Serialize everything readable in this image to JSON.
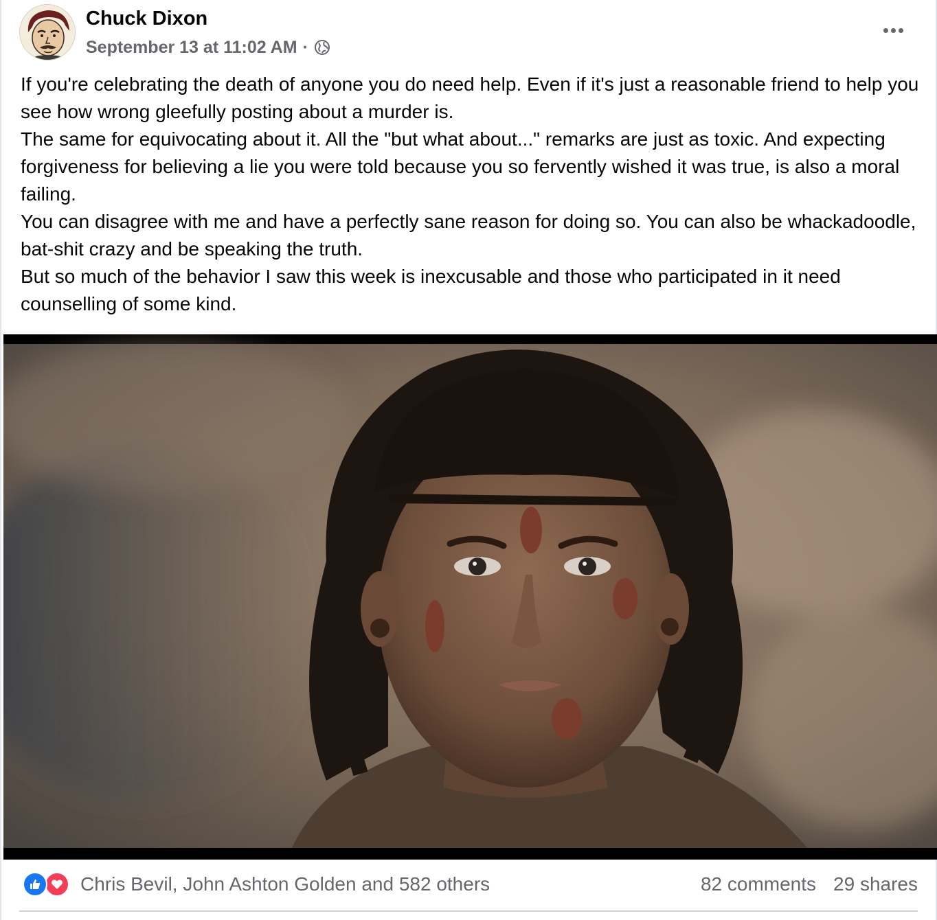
{
  "post": {
    "author": "Chuck Dixon",
    "timestamp": "September 13 at 11:02 AM",
    "separator": "·",
    "privacy_icon": "globe-icon",
    "more_icon": "more-horizontal-icon",
    "paragraphs": [
      "If you're celebrating the death of anyone you do need help. Even if it's just a reasonable friend to help you see how wrong gleefully posting about a murder is.",
      "The same for equivocating about it. All the \"but what about...\" remarks are just as toxic. And expecting forgiveness for believing a lie you were told because you so fervently wished it was true, is also a moral failing.",
      "You can disagree with me and have a perfectly sane reason for doing so. You can also be whackadoodle, bat-shit crazy and be speaking the truth.",
      "But so much of the behavior I saw this week is inexcusable and those who participated in it need counselling of some kind."
    ]
  },
  "footer": {
    "reactions_text": "Chris Bevil, John Ashton Golden and 582 others",
    "reaction_icons": [
      "like-icon",
      "love-icon"
    ],
    "comments": "82 comments",
    "shares": "29 shares"
  },
  "colors": {
    "text_primary": "#050505",
    "text_secondary": "#65676b",
    "like_blue": "#1877f2",
    "love_red": "#f33e58",
    "divider": "#ced0d4"
  }
}
